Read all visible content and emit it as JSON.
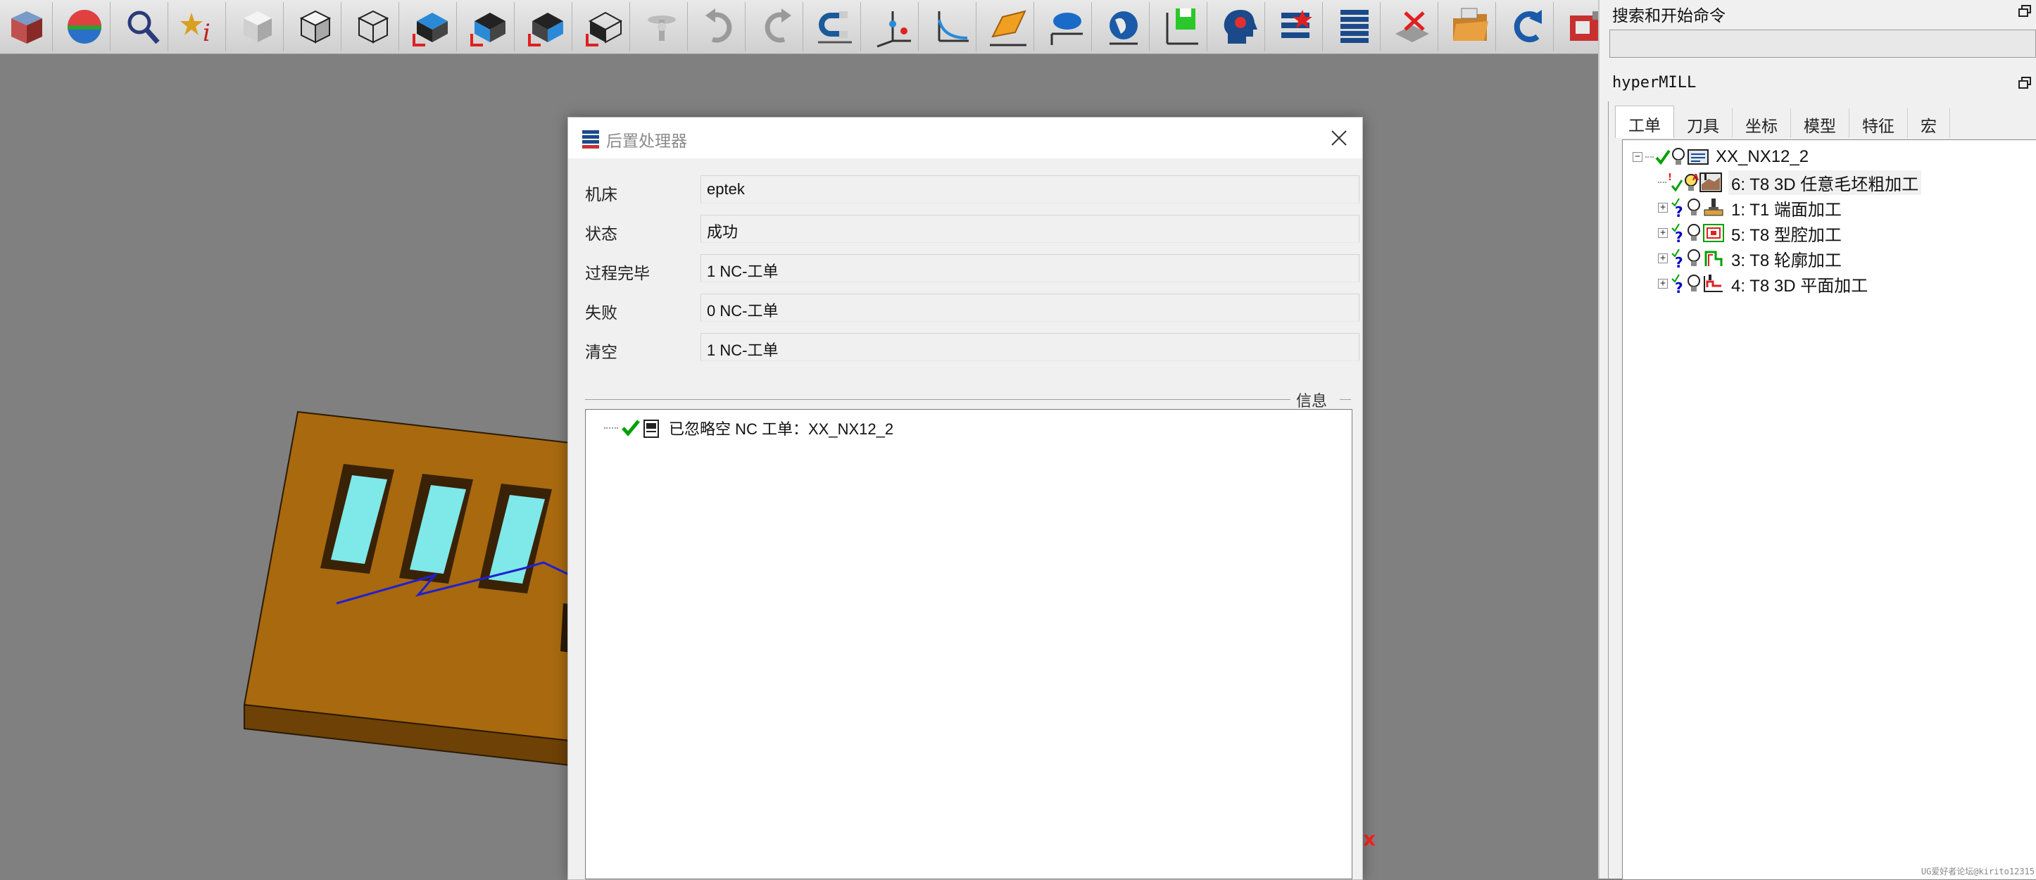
{
  "toolbar": {
    "icons": [
      "solid-cube-icon",
      "color-sphere-icon",
      "magnifier-icon",
      "star-info-icon",
      "shaded-cube-icon",
      "shaded-edges-cube-icon",
      "wireframe-cube-icon",
      "view-top-icon",
      "view-front-icon",
      "view-right-icon",
      "view-iso-icon",
      "plane-tool-icon",
      "undo-icon",
      "redo-icon",
      "magnet-icon",
      "points-axis-icon",
      "curve-axis-icon",
      "surface-icon",
      "cloud-plane-icon",
      "globe-icon",
      "export-icon",
      "head-gear-icon",
      "favorites-icon",
      "job-list-icon",
      "tool-delete-icon",
      "folder-open-icon",
      "refresh-icon",
      "machine-icon"
    ]
  },
  "dialog": {
    "title": "后置处理器",
    "fields": [
      {
        "label": "机床",
        "value": "eptek"
      },
      {
        "label": "状态",
        "value": "成功"
      },
      {
        "label": "过程完毕",
        "value": "1 NC-工单"
      },
      {
        "label": "失败",
        "value": "0 NC-工单"
      },
      {
        "label": "清空",
        "value": "1 NC-工单"
      }
    ],
    "info_label": "信息",
    "info_items": [
      {
        "text": "已忽略空 NC 工单：XX_NX12_2"
      }
    ]
  },
  "search_panel": {
    "title": "搜索和开始命令",
    "input_value": ""
  },
  "hypermill_panel": {
    "title": "hyperMILL",
    "tabs": [
      "工单",
      "刀具",
      "坐标",
      "模型",
      "特征",
      "宏"
    ],
    "active_tab": "工单",
    "tree": {
      "root": "XX_NX12_2",
      "jobs": [
        "6: T8 3D 任意毛坯粗加工",
        "1: T1 端面加工",
        "5: T8 型腔加工",
        "3: T8 轮廓加工",
        "4: T8 3D 平面加工"
      ]
    }
  },
  "viewport": {
    "axis_marker": "x"
  },
  "watermark": "UG爱好者论坛@kirito12315",
  "colors": {
    "viewport_bg": "#808080",
    "part_top": "#a8690f",
    "part_side": "#6e4106",
    "pocket": "#7fe8e8",
    "toolpath": "#2020d0",
    "check_green": "#00a000",
    "question_blue": "#0000c8"
  }
}
